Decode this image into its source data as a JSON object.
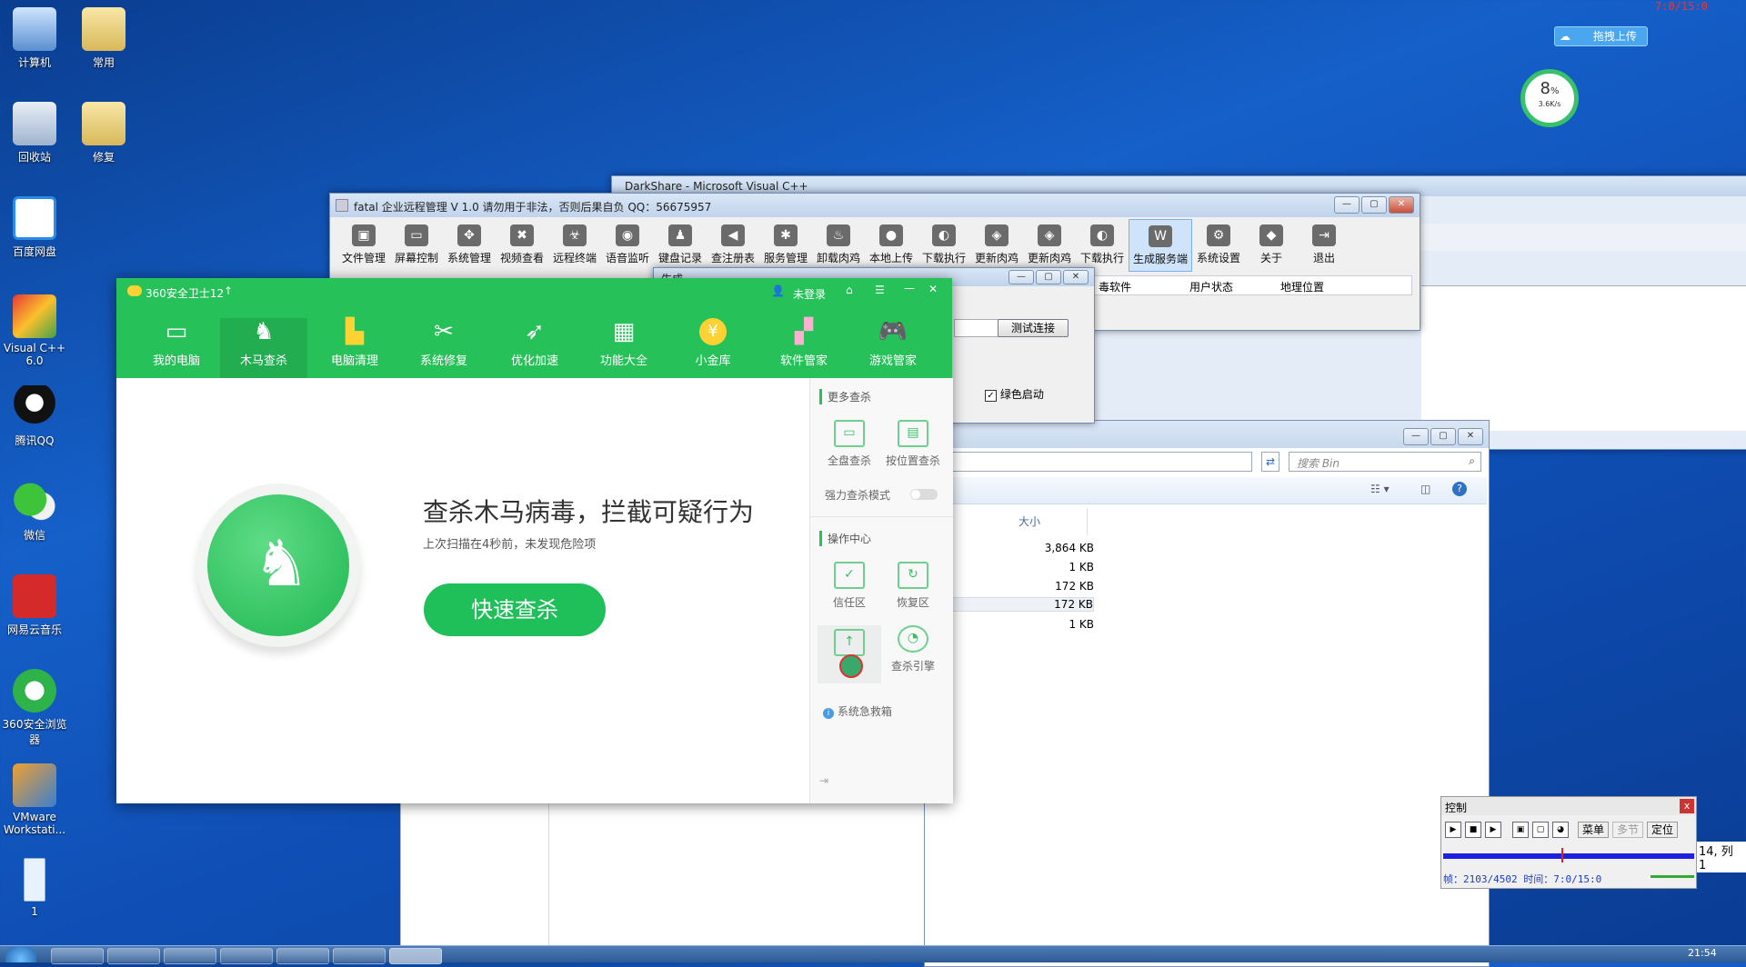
{
  "desktop": {
    "icons": [
      {
        "label": "计算机"
      },
      {
        "label": "常用"
      },
      {
        "label": "回收站"
      },
      {
        "label": "修复"
      },
      {
        "label": "百度网盘"
      },
      {
        "label": "Visual C++ 6.0"
      },
      {
        "label": "腾讯QQ"
      },
      {
        "label": "微信"
      },
      {
        "label": "网易云音乐"
      },
      {
        "label": "360安全浏览器"
      },
      {
        "label": "VMware Workstati..."
      },
      {
        "label": "1"
      }
    ],
    "top_right_counter": "7:0/15:0",
    "upload_button": "拖拽上传",
    "speed_widget": {
      "percent": "8",
      "unit": "%",
      "rate": "3.6K/s"
    }
  },
  "vs_window": {
    "title": "DarkShare - Microsoft Visual C++"
  },
  "fatal_window": {
    "title": "fatal 企业远程管理 V 1.0 请勿用于非法，否则后果自负  QQ：56675957",
    "toolbar": [
      {
        "label": "文件管理",
        "icon": "folder-icon"
      },
      {
        "label": "屏幕控制",
        "icon": "monitor-icon"
      },
      {
        "label": "系统管理",
        "icon": "system-icon"
      },
      {
        "label": "视频查看",
        "icon": "video-icon"
      },
      {
        "label": "远程终端",
        "icon": "terminal-icon"
      },
      {
        "label": "语音监听",
        "icon": "audio-icon"
      },
      {
        "label": "键盘记录",
        "icon": "keyboard-icon"
      },
      {
        "label": "查注册表",
        "icon": "registry-icon"
      },
      {
        "label": "服务管理",
        "icon": "service-icon"
      },
      {
        "label": "卸载肉鸡",
        "icon": "uninstall-icon"
      },
      {
        "label": "本地上传",
        "icon": "upload-icon"
      },
      {
        "label": "下载执行",
        "icon": "download-icon"
      },
      {
        "label": "更新肉鸡",
        "icon": "update-icon"
      },
      {
        "label": "更新肉鸡",
        "icon": "update-icon"
      },
      {
        "label": "下载执行",
        "icon": "download-icon"
      },
      {
        "label": "生成服务端",
        "icon": "build-icon"
      },
      {
        "label": "系统设置",
        "icon": "settings-icon"
      },
      {
        "label": "关于",
        "icon": "about-icon"
      },
      {
        "label": "退出",
        "icon": "exit-icon"
      }
    ],
    "columns": [
      "毒软件",
      "用户状态",
      "地理位置"
    ],
    "generate_dialog": {
      "title": "生成",
      "test_button": "测试连接",
      "green_checkbox": "绿色启动"
    }
  },
  "explorer": {
    "search_placeholder": "搜索 Bin",
    "size_header": "大小",
    "sizes": [
      "3,864 KB",
      "1 KB",
      "172 KB",
      "172 KB",
      "1 KB"
    ]
  },
  "s360": {
    "title": "360安全卫士12",
    "login": "未登录",
    "nav": [
      {
        "label": "我的电脑",
        "icon": "monitor-icon"
      },
      {
        "label": "木马查杀",
        "icon": "horse-icon"
      },
      {
        "label": "电脑清理",
        "icon": "broom-icon"
      },
      {
        "label": "系统修复",
        "icon": "tools-icon"
      },
      {
        "label": "优化加速",
        "icon": "rocket-icon"
      },
      {
        "label": "功能大全",
        "icon": "grid-icon"
      },
      {
        "label": "小金库",
        "icon": "yen-icon"
      },
      {
        "label": "软件管家",
        "icon": "apps-icon"
      },
      {
        "label": "游戏管家",
        "icon": "gamepad-icon"
      }
    ],
    "headline": "查杀木马病毒，拦截可疑行为",
    "subline": "上次扫描在4秒前，未发现危险项",
    "scan_button": "快速查杀",
    "side": {
      "more_title": "更多查杀",
      "full_scan": "全盘查杀",
      "custom_scan": "按位置查杀",
      "strong_mode": "强力查杀模式",
      "center_title": "操作中心",
      "trust": "信任区",
      "restore": "恢复区",
      "engine": "查杀引擎",
      "rescue": "系统急救箱"
    },
    "colors": {
      "green": "#27c15a",
      "button": "#1fc05a"
    }
  },
  "control_panel": {
    "title": "控制",
    "close": "x",
    "menu": "菜单",
    "multi": "多节",
    "locate": "定位",
    "frame_info": "帧：2103/4502 时间：7:0/15:0",
    "side_text": "14, 列 1",
    "progress": 0.47
  },
  "taskbar": {
    "time": "21:54"
  }
}
